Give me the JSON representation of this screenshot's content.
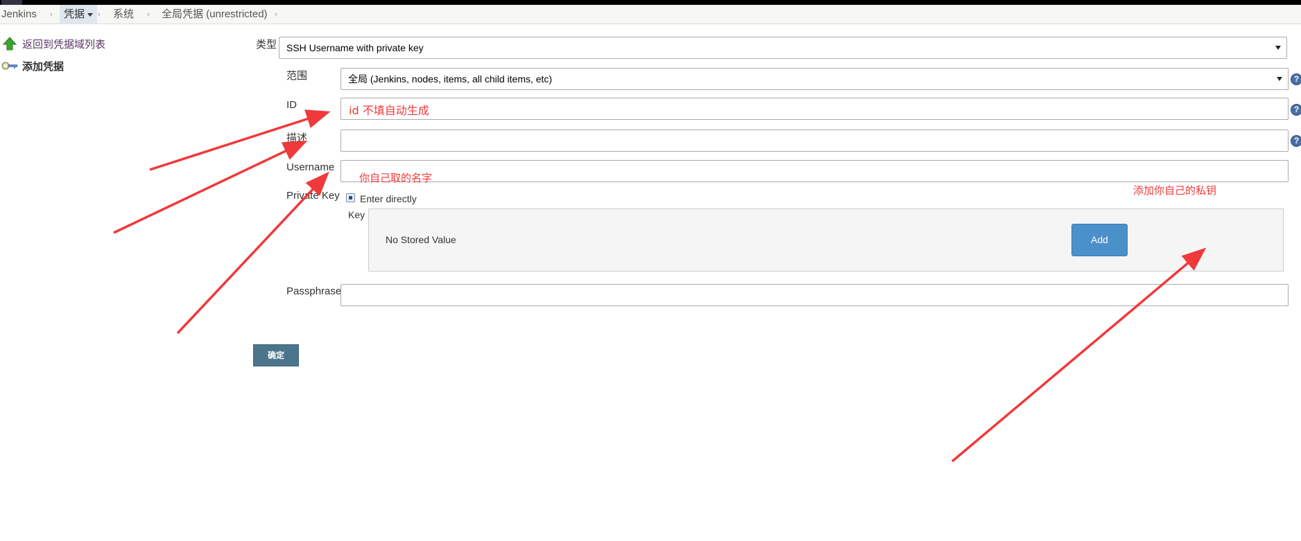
{
  "breadcrumb": [
    {
      "label": "Jenkins"
    },
    {
      "label": "凭据",
      "active": true
    },
    {
      "label": "系统"
    },
    {
      "label": "全局凭据 (unrestricted)"
    }
  ],
  "sidebar": {
    "tasks": [
      {
        "label": "返回到凭据域列表",
        "icon": "up-arrow-icon"
      },
      {
        "label": "添加凭据",
        "icon": "key-icon"
      }
    ]
  },
  "form": {
    "kind_label": "类型",
    "kind_value": "SSH Username with private key",
    "scope_label": "范围",
    "scope_value": "全局 (Jenkins, nodes, items, all child items, etc)",
    "id_label": "ID",
    "id_value": "",
    "description_label": "描述",
    "description_value": "",
    "username_label": "Username",
    "username_value": "",
    "private_key_label": "Private Key",
    "enter_directly_label": "Enter directly",
    "key_label": "Key",
    "no_stored_value": "No Stored Value",
    "add_label": "Add",
    "passphrase_label": "Passphrase",
    "passphrase_value": "",
    "help_glyph": "?"
  },
  "submit_label": "确定",
  "annotations": {
    "id_note": "id 不填自动生成",
    "username_note": "你自己取的名字",
    "key_note": "添加你自己的私钥"
  },
  "colors": {
    "annotation_red": "#f0393a",
    "add_button_blue": "#4a90c9",
    "ok_button": "#4b758b"
  }
}
